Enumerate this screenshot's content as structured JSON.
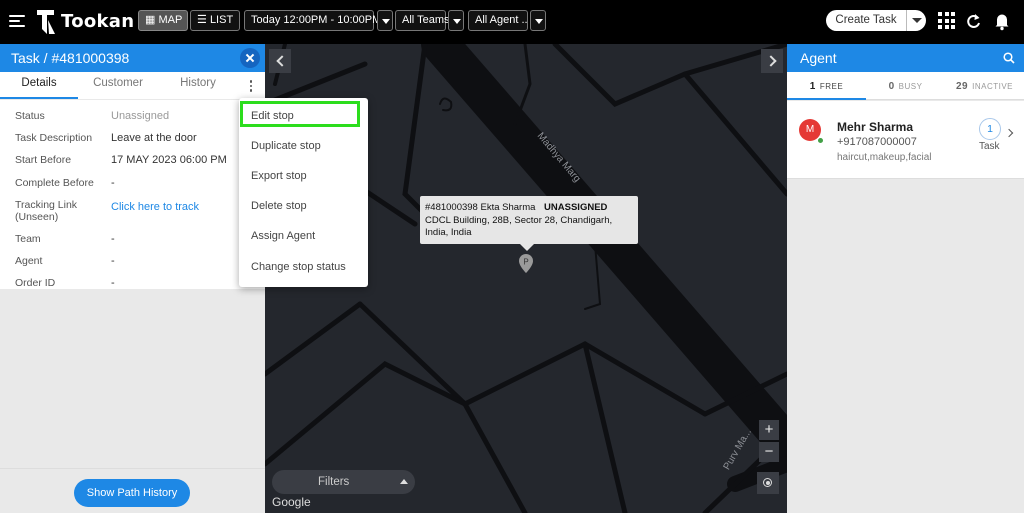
{
  "header": {
    "logo_text": "Tookan",
    "map_label": "MAP",
    "list_label": "LIST",
    "time_filter": "Today 12:00PM - 10:00PM",
    "team_filter": "All Teams",
    "agent_filter": "All Agent ..",
    "create_task_label": "Create Task"
  },
  "task_panel": {
    "title": "Task / #481000398",
    "tabs": [
      "Details",
      "Customer",
      "History"
    ],
    "active_tab": "Details",
    "details": [
      {
        "label": "Status",
        "value": "Unassigned"
      },
      {
        "label": "Task Description",
        "value": "Leave at the door"
      },
      {
        "label": "Start Before",
        "value": "17 MAY 2023 06:00 PM"
      },
      {
        "label": "Complete Before",
        "value": "-"
      },
      {
        "label": "Tracking Link (Unseen)",
        "value": "Click here to track"
      },
      {
        "label": "Team",
        "value": "-"
      },
      {
        "label": "Agent",
        "value": "-"
      },
      {
        "label": "Order ID",
        "value": "-"
      }
    ],
    "show_path_history_label": "Show Path History"
  },
  "stop_menu": {
    "items": [
      "Edit stop",
      "Duplicate stop",
      "Export stop",
      "Delete stop",
      "Assign Agent",
      "Change stop status"
    ],
    "highlighted": "Edit stop"
  },
  "map": {
    "tooltip": {
      "task_id": "#481000398",
      "customer": "Ekta Sharma",
      "status": "UNASSIGNED",
      "address": "CDCL Building, 28B, Sector 28, Chandigarh, India, India"
    },
    "road_labels": [
      "Madhya Marg",
      "Purv Ma..."
    ],
    "zoom_in": "+",
    "zoom_out": "−",
    "filters_label": "Filters",
    "google_label": "Google"
  },
  "agent_panel": {
    "title": "Agent",
    "tabs": [
      {
        "count": "1",
        "label": "FREE"
      },
      {
        "count": "0",
        "label": "BUSY"
      },
      {
        "count": "29",
        "label": "INACTIVE"
      }
    ],
    "agents": [
      {
        "initial": "M",
        "name": "Mehr Sharma",
        "phone": "+917087000007",
        "tags": "haircut,makeup,facial",
        "task_count": "1",
        "task_label": "Task"
      }
    ]
  },
  "colors": {
    "primary": "#1e88e5",
    "topbar": "#000000",
    "map_bg": "#24272d",
    "highlight": "#2cdd1d",
    "avatar": "#e53935",
    "online": "#43a047"
  }
}
